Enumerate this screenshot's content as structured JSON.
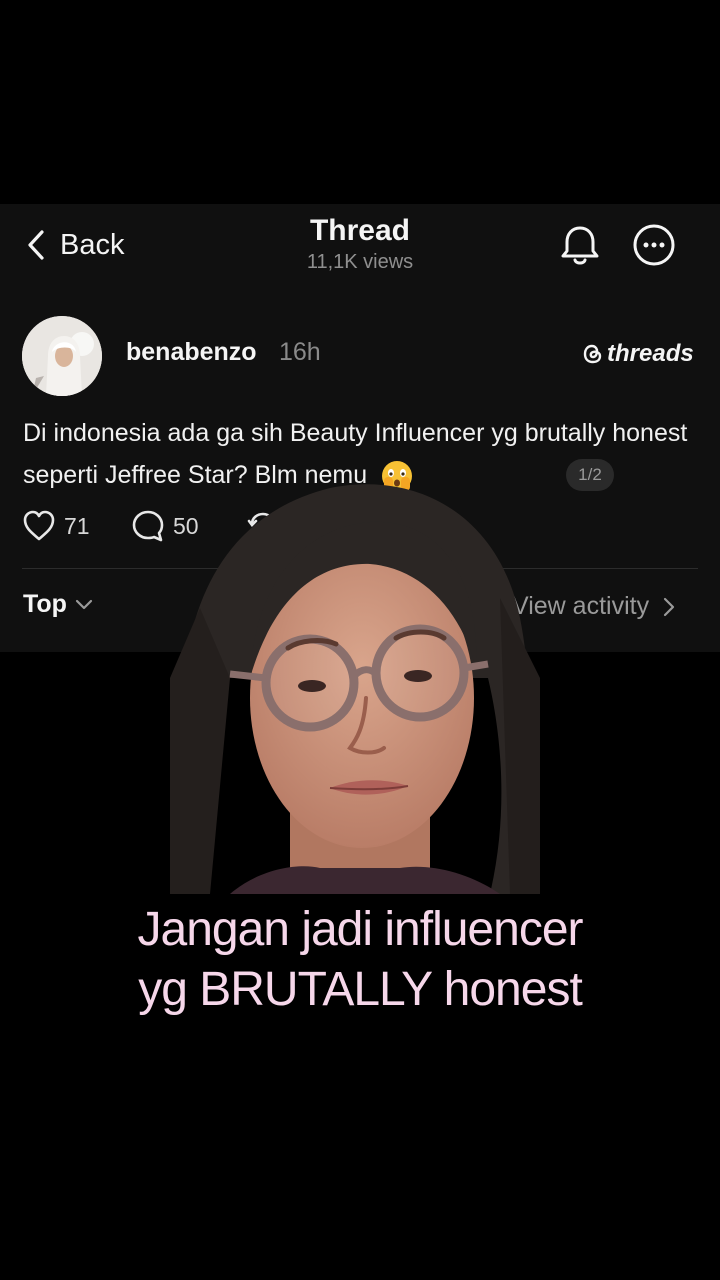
{
  "header": {
    "back_label": "Back",
    "title": "Thread",
    "views": "11,1K views"
  },
  "post": {
    "username": "benabenzo",
    "time": "16h",
    "brand": "threads",
    "text": "Di indonesia ada ga sih Beauty Influencer yg brutally honest seperti Jeffree Star? Blm nemu",
    "emoji": "🫣",
    "pager": "1/2",
    "likes": "71",
    "comments": "50"
  },
  "filters": {
    "sort_label": "Top",
    "activity_label": "View activity"
  },
  "caption": {
    "line1": "Jangan jadi influencer",
    "line2": "yg BRUTALLY honest"
  },
  "colors": {
    "panel_bg": "#101010",
    "caption": "#f6d7ea",
    "muted": "#8f8f8f"
  }
}
